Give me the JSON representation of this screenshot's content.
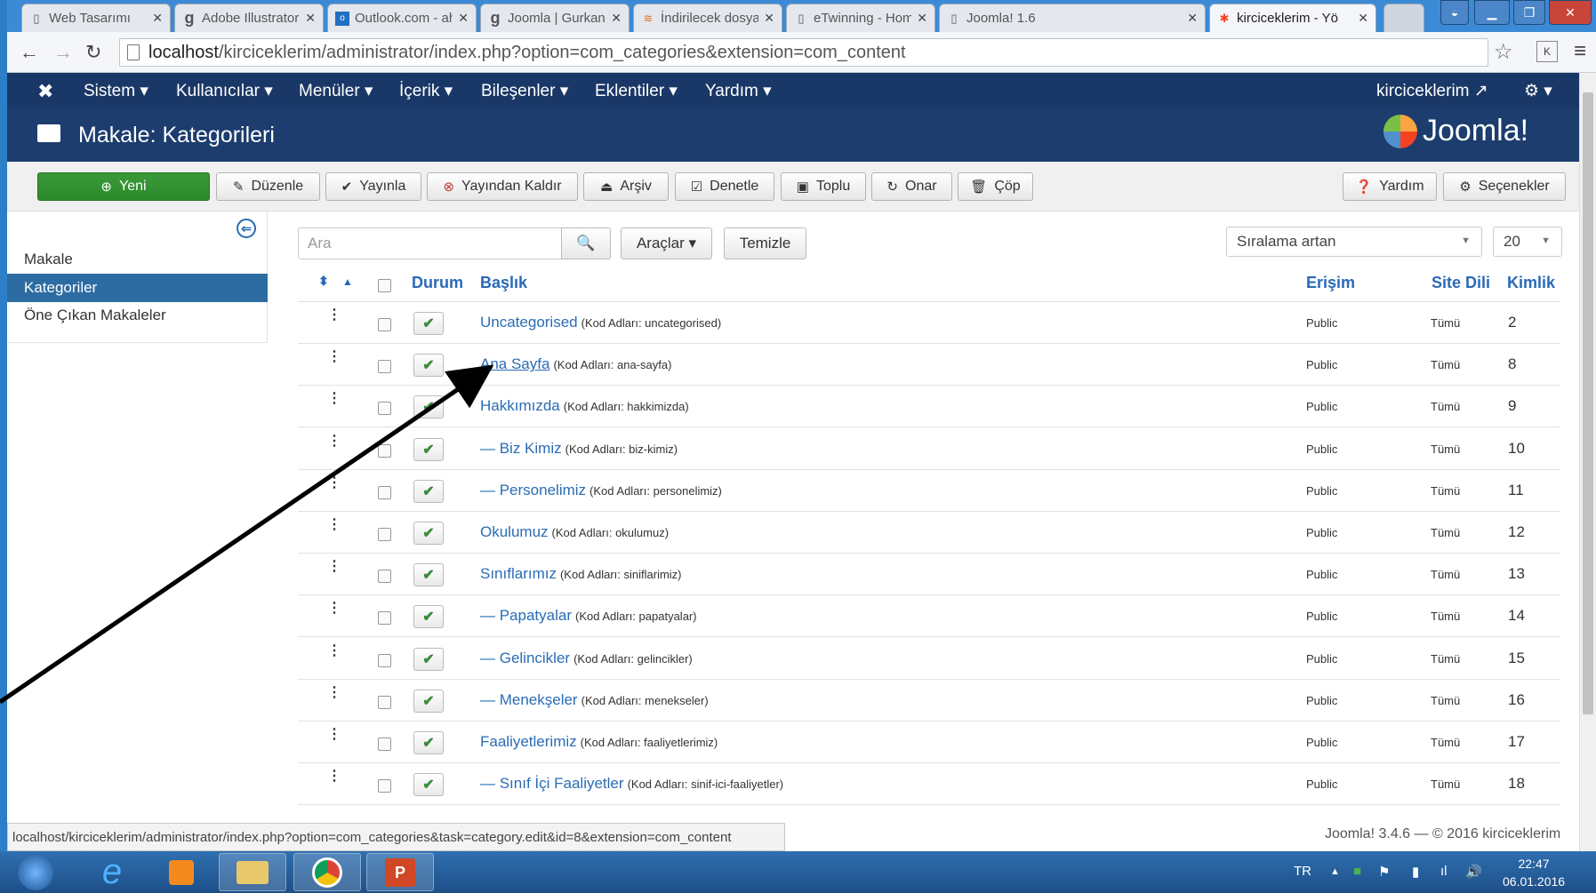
{
  "browser": {
    "tabs": [
      {
        "label": "Web Tasarımı",
        "icon": "page-icon"
      },
      {
        "label": "Adobe Illustrator",
        "icon": "g-icon"
      },
      {
        "label": "Outlook.com - ah",
        "icon": "outlook-icon"
      },
      {
        "label": "Joomla | Gurkanc",
        "icon": "g-icon"
      },
      {
        "label": "İndirilecek dosya",
        "icon": "download-icon"
      },
      {
        "label": "eTwinning - Hom",
        "icon": "page-icon"
      },
      {
        "label": "Joomla! 1.6",
        "icon": "page-icon"
      },
      {
        "label": "kirciceklerim - Yö",
        "icon": "joomla-icon"
      }
    ],
    "url_host": "localhost",
    "url_path": "/kirciceklerim/administrator/index.php?option=com_categories&extension=com_content",
    "ext_button": "K",
    "status_url": "localhost/kirciceklerim/administrator/index.php?option=com_categories&task=category.edit&id=8&extension=com_content"
  },
  "topnav": {
    "items": [
      "Sistem ▾",
      "Kullanıcılar ▾",
      "Menüler ▾",
      "İçerik ▾",
      "Bileşenler ▾",
      "Eklentiler ▾",
      "Yardım ▾"
    ],
    "site_link": "kirciceklerim ↗",
    "settings": "⚙ ▾"
  },
  "header": {
    "title": "Makale: Kategorileri",
    "logo": "Joomla!"
  },
  "toolbar": {
    "new": "Yeni",
    "edit": "Düzenle",
    "publish": "Yayınla",
    "unpublish": "Yayından Kaldır",
    "archive": "Arşiv",
    "checkin": "Denetle",
    "batch": "Toplu",
    "rebuild": "Onar",
    "trash": "Çöp",
    "help": "Yardım",
    "options": "Seçenekler"
  },
  "sidebar": {
    "items": [
      {
        "label": "Makale",
        "active": false
      },
      {
        "label": "Kategoriler",
        "active": true
      },
      {
        "label": "Öne Çıkan Makaleler",
        "active": false
      }
    ]
  },
  "filters": {
    "search_placeholder": "Ara",
    "tools": "Araçlar ▾",
    "clear": "Temizle",
    "ordering": "Sıralama artan",
    "limit": "20"
  },
  "table": {
    "columns": {
      "status": "Durum",
      "title": "Başlık",
      "access": "Erişim",
      "language": "Site Dili",
      "id": "Kimlik"
    },
    "rows": [
      {
        "name": "Uncategorised",
        "alias": "(Kod Adları: uncategorised)",
        "access": "Public",
        "lang": "Tümü",
        "id": "2"
      },
      {
        "name": "Ana Sayfa",
        "alias": "(Kod Adları: ana-sayfa)",
        "access": "Public",
        "lang": "Tümü",
        "id": "8"
      },
      {
        "name": "Hakkımızda",
        "alias": "(Kod Adları: hakkimizda)",
        "access": "Public",
        "lang": "Tümü",
        "id": "9"
      },
      {
        "name": "— Biz Kimiz",
        "alias": "(Kod Adları: biz-kimiz)",
        "access": "Public",
        "lang": "Tümü",
        "id": "10"
      },
      {
        "name": "— Personelimiz",
        "alias": "(Kod Adları: personelimiz)",
        "access": "Public",
        "lang": "Tümü",
        "id": "11"
      },
      {
        "name": "Okulumuz",
        "alias": "(Kod Adları: okulumuz)",
        "access": "Public",
        "lang": "Tümü",
        "id": "12"
      },
      {
        "name": "Sınıflarımız",
        "alias": "(Kod Adları: siniflarimiz)",
        "access": "Public",
        "lang": "Tümü",
        "id": "13"
      },
      {
        "name": "— Papatyalar",
        "alias": "(Kod Adları: papatyalar)",
        "access": "Public",
        "lang": "Tümü",
        "id": "14"
      },
      {
        "name": "— Gelincikler",
        "alias": "(Kod Adları: gelincikler)",
        "access": "Public",
        "lang": "Tümü",
        "id": "15"
      },
      {
        "name": "— Menekşeler",
        "alias": "(Kod Adları: menekseler)",
        "access": "Public",
        "lang": "Tümü",
        "id": "16"
      },
      {
        "name": "Faaliyetlerimiz",
        "alias": "(Kod Adları: faaliyetlerimiz)",
        "access": "Public",
        "lang": "Tümü",
        "id": "17"
      },
      {
        "name": "— Sınıf İçi Faaliyetler",
        "alias": "(Kod Adları: sinif-ici-faaliyetler)",
        "access": "Public",
        "lang": "Tümü",
        "id": "18"
      }
    ]
  },
  "footer": "Joomla! 3.4.6 — © 2016 kirciceklerim",
  "taskbar": {
    "lang": "TR",
    "time": "22:47",
    "date": "06.01.2016"
  },
  "colors": {
    "navbar": "#1a3867",
    "header": "#1c3d6e",
    "link": "#2a6cb4",
    "new_button": "#2b8a2b",
    "active_sidebar": "#2d6ca2"
  }
}
